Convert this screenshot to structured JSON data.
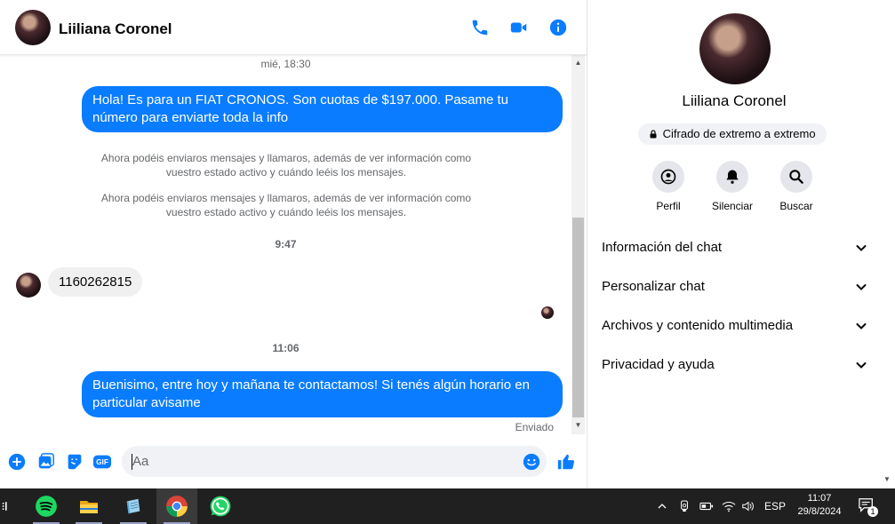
{
  "chat": {
    "contact_name": "Liiliana Coronel",
    "messages": [
      {
        "type": "timestamp",
        "text": "mié, 18:30"
      },
      {
        "type": "outgoing",
        "text": "Hola! Es para un FIAT CRONOS. Son cuotas de $197.000. Pasame tu número para enviarte toda la info"
      },
      {
        "type": "system",
        "text": "Ahora podéis enviaros mensajes y llamaros, además de ver información como vuestro estado activo y cuándo leéis los mensajes."
      },
      {
        "type": "system",
        "text": "Ahora podéis enviaros mensajes y llamaros, además de ver información como vuestro estado activo y cuándo leéis los mensajes."
      },
      {
        "type": "timestamp",
        "text": "9:47"
      },
      {
        "type": "incoming",
        "text": "1160262815"
      },
      {
        "type": "timestamp",
        "text": "11:06"
      },
      {
        "type": "outgoing",
        "text": "Buenisimo, entre hoy y mañana te contactamos! Si tenés algún horario en particular avisame"
      }
    ],
    "sent_status": "Enviado",
    "composer": {
      "placeholder": "Aa",
      "gif_label": "GIF"
    },
    "accent_color": "#0a7cff"
  },
  "info": {
    "name": "Liiliana Coronel",
    "e2e_badge": "Cifrado de extremo a extremo",
    "actions": [
      {
        "label": "Perfil",
        "icon": "profile-icon"
      },
      {
        "label": "Silenciar",
        "icon": "bell-icon"
      },
      {
        "label": "Buscar",
        "icon": "search-icon"
      }
    ],
    "sections": [
      {
        "label": "Información del chat"
      },
      {
        "label": "Personalizar chat"
      },
      {
        "label": "Archivos y contenido multimedia"
      },
      {
        "label": "Privacidad y ayuda"
      }
    ]
  },
  "taskbar": {
    "apps": [
      "spotify-icon",
      "file-explorer-icon",
      "notepad-icon",
      "chrome-icon",
      "whatsapp-icon"
    ],
    "language": "ESP",
    "time": "11:07",
    "date": "29/8/2024",
    "notification_count": "1"
  }
}
